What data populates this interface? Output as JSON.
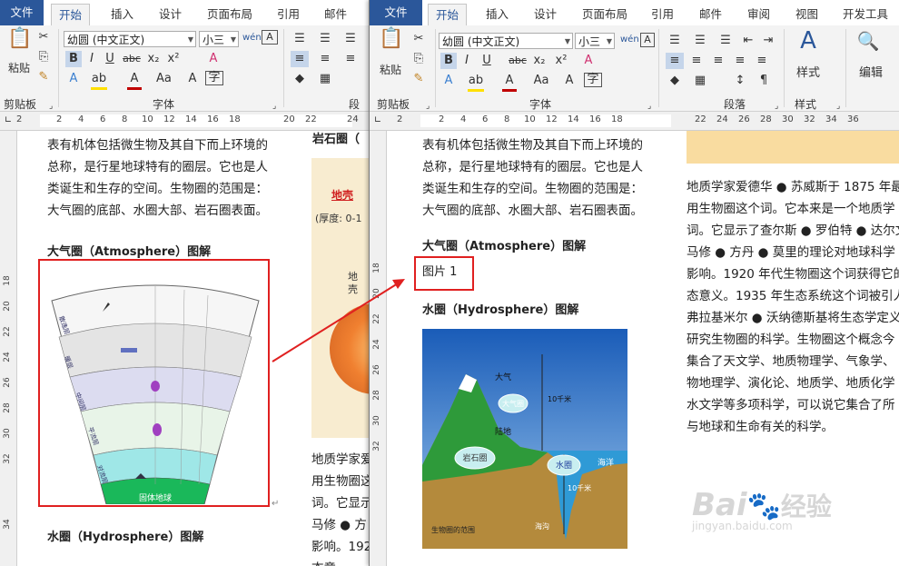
{
  "left_window": {
    "tabs": [
      "文件",
      "开始",
      "插入",
      "设计",
      "页面布局",
      "引用",
      "邮件"
    ],
    "active_tab": "开始",
    "font_name": "幼圆 (中文正文)",
    "font_size": "小三",
    "groups": [
      "剪贴板",
      "字体",
      "段落"
    ],
    "paste_label": "粘贴",
    "ruler_numbers": [
      "2",
      "2",
      "4",
      "6",
      "8",
      "10",
      "12",
      "14",
      "16",
      "18",
      "20",
      "22",
      "24"
    ],
    "vruler_numbers": [
      "18",
      "20",
      "22",
      "24",
      "26",
      "28",
      "30",
      "32",
      "34"
    ],
    "body_lines": [
      "表有机体包括微生物及其自下而上环境的",
      "总称，是行星地球特有的圈层。它也是人",
      "类诞生和生存的空间。生物圈的范围是：",
      "大气圈的底部、水圈大部、岩石圈表面。"
    ],
    "heading_atmosphere": "大气圈（Atmosphere）图解",
    "heading_hydrosphere": "水圈（Hydrosphere）图解",
    "diagram_labels": {
      "bottom": "固体地球",
      "left_outer": "散逸层",
      "left_thermo": "暖层",
      "left_meso": "中间层",
      "left_strato": "平流层",
      "left_tropo": "对流层"
    },
    "right_col_heading": "岩石圈（",
    "crust_title": "地壳",
    "crust_thickness": "(厚度: 0-1",
    "crust_side": "地壳",
    "right_col_lines": [
      "地质学家爱",
      "用生物圈这",
      "词。它显示",
      "马修 ● 方",
      "影响。192",
      "态意"
    ]
  },
  "right_window": {
    "tabs": [
      "文件",
      "开始",
      "插入",
      "设计",
      "页面布局",
      "引用",
      "邮件",
      "审阅",
      "视图",
      "开发工具"
    ],
    "active_tab": "开始",
    "font_name": "幼圆 (中文正文)",
    "font_size": "小三",
    "groups": [
      "剪贴板",
      "字体",
      "段落",
      "样式"
    ],
    "paste_label": "粘贴",
    "styles_label": "样式",
    "edit_label": "编辑",
    "ruler_numbers": [
      "2",
      "2",
      "4",
      "6",
      "8",
      "10",
      "12",
      "14",
      "16",
      "18",
      "22",
      "24",
      "26",
      "28",
      "30",
      "32",
      "34",
      "36"
    ],
    "vruler_numbers": [
      "18",
      "20",
      "22",
      "24",
      "26",
      "28",
      "30",
      "32"
    ],
    "body_lines": [
      "表有机体包括微生物及其自下而上环境的",
      "总称，是行星地球特有的圈层。它也是人",
      "类诞生和生存的空间。生物圈的范围是：",
      "大气圈的底部、水圈大部、岩石圈表面。"
    ],
    "heading_atmosphere": "大气圈（Atmosphere）图解",
    "picture_placeholder": "图片 1",
    "heading_hydrosphere": "水圈（Hydrosphere）图解",
    "hydro_labels": {
      "atmosphere": "大气",
      "atmosphere_circle": "大气圈",
      "land": "陆地",
      "lithosphere": "岩石圈",
      "hydrosphere": "水圈",
      "ocean": "海洋",
      "ten_km_top": "10千米",
      "ten_km_bottom": "10千米",
      "trench": "海沟",
      "biosphere_range": "生物圈的范围"
    },
    "right_col_lines": [
      "地质学家爱德华 ● 苏威斯于 1875 年最",
      "用生物圈这个词。它本来是一个地质学",
      "词。它显示了查尔斯 ● 罗伯特 ● 达尔文",
      "马修 ●  方丹 ●  莫里的理论对地球科学",
      "影响。1920 年代生物圈这个词获得它的",
      "态意义。1935 年生态系统这个词被引人",
      "弗拉基米尔 ● 沃纳德斯基将生态学定义",
      "研究生物圈的科学。生物圈这个概念今",
      "集合了天文学、地质物理学、气象学、",
      "物地理学、演化论、地质学、地质化学",
      "水文学等多项科学，可以说它集合了所",
      "与地球和生命有关的科学。"
    ]
  },
  "watermark": {
    "text_top": "Bai",
    "text_after": "经验",
    "url": "jingyan.baidu.com"
  },
  "colors": {
    "file_tab": "#2b579a",
    "highlight_box": "#e02020",
    "arrow": "#e02020",
    "sky": "#2f78c8",
    "ocean": "#3aa0d8",
    "mountain": "#2e9a3a"
  }
}
